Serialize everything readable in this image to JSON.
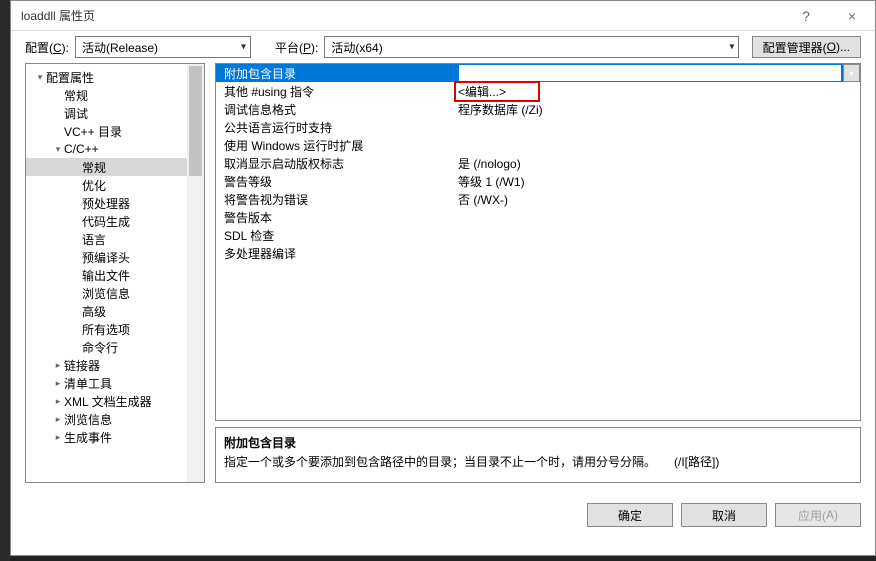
{
  "window": {
    "title": "loaddll 属性页",
    "help": "?",
    "close": "×"
  },
  "configRow": {
    "configLabelPre": "配置(",
    "configLabelU": "C",
    "configLabelPost": "):",
    "configValue": "活动(Release)",
    "platformLabelPre": "平台(",
    "platformLabelU": "P",
    "platformLabelPost": "):",
    "platformValue": "活动(x64)",
    "managerBtnPre": "配置管理器(",
    "managerBtnU": "O",
    "managerBtnPost": ")..."
  },
  "tree": [
    {
      "label": "配置属性",
      "depth": 0,
      "exp": "▾"
    },
    {
      "label": "常规",
      "depth": 1,
      "exp": ""
    },
    {
      "label": "调试",
      "depth": 1,
      "exp": ""
    },
    {
      "label": "VC++ 目录",
      "depth": 1,
      "exp": ""
    },
    {
      "label": "C/C++",
      "depth": 1,
      "exp": "▾"
    },
    {
      "label": "常规",
      "depth": 2,
      "exp": "",
      "sel": true
    },
    {
      "label": "优化",
      "depth": 2,
      "exp": ""
    },
    {
      "label": "预处理器",
      "depth": 2,
      "exp": ""
    },
    {
      "label": "代码生成",
      "depth": 2,
      "exp": ""
    },
    {
      "label": "语言",
      "depth": 2,
      "exp": ""
    },
    {
      "label": "预编译头",
      "depth": 2,
      "exp": ""
    },
    {
      "label": "输出文件",
      "depth": 2,
      "exp": ""
    },
    {
      "label": "浏览信息",
      "depth": 2,
      "exp": ""
    },
    {
      "label": "高级",
      "depth": 2,
      "exp": ""
    },
    {
      "label": "所有选项",
      "depth": 2,
      "exp": ""
    },
    {
      "label": "命令行",
      "depth": 2,
      "exp": ""
    },
    {
      "label": "链接器",
      "depth": 1,
      "exp": "▸"
    },
    {
      "label": "清单工具",
      "depth": 1,
      "exp": "▸"
    },
    {
      "label": "XML 文档生成器",
      "depth": 1,
      "exp": "▸"
    },
    {
      "label": "浏览信息",
      "depth": 1,
      "exp": "▸"
    },
    {
      "label": "生成事件",
      "depth": 1,
      "exp": "▸"
    }
  ],
  "props": [
    {
      "name": "附加包含目录",
      "val": "",
      "sel": true
    },
    {
      "name": "其他 #using 指令",
      "val": "<编辑...>",
      "highlight": true
    },
    {
      "name": "调试信息格式",
      "val": "程序数据库 (/Zi)"
    },
    {
      "name": "公共语言运行时支持",
      "val": ""
    },
    {
      "name": "使用 Windows 运行时扩展",
      "val": ""
    },
    {
      "name": "取消显示启动版权标志",
      "val": "是 (/nologo)"
    },
    {
      "name": "警告等级",
      "val": "等级 1 (/W1)"
    },
    {
      "name": "将警告视为错误",
      "val": "否 (/WX-)"
    },
    {
      "name": "警告版本",
      "val": ""
    },
    {
      "name": "SDL 检查",
      "val": ""
    },
    {
      "name": "多处理器编译",
      "val": ""
    }
  ],
  "desc": {
    "title": "附加包含目录",
    "body": "指定一个或多个要添加到包含路径中的目录；当目录不止一个时，请用分号分隔。　　(/I[路径])"
  },
  "footer": {
    "ok": "确定",
    "cancel": "取消",
    "applyPre": "应用(",
    "applyU": "A",
    "applyPost": ")"
  }
}
